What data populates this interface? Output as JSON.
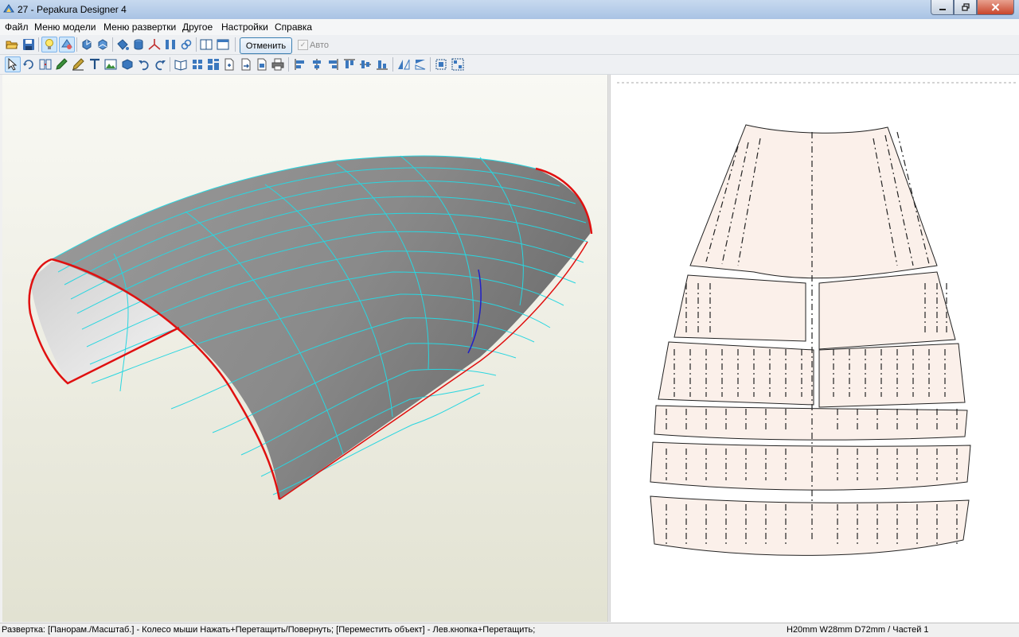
{
  "window": {
    "title": "27 - Pepakura Designer 4"
  },
  "menu": [
    "Файл",
    "Меню модели",
    "Меню развертки",
    "Другое",
    "Настройки",
    "Справка"
  ],
  "toolbar": {
    "undo_label": "Отменить",
    "auto_label": "Авто",
    "auto_checked": true
  },
  "toolbar1_icons": [
    "open-icon",
    "save-icon",
    "lightbulb-icon",
    "texture-icon",
    "rotate-model-icon",
    "flip-model-icon",
    "paint-bucket-icon",
    "cylinder-icon",
    "axes-icon",
    "split-view-icon",
    "link-icon",
    "dual-pane-icon",
    "single-pane-icon"
  ],
  "toolbar2_icons": [
    "select-arrow-icon",
    "rotate-part-icon",
    "join-parts-icon",
    "pen-edit-icon",
    "flap-edit-icon",
    "text-icon",
    "image-icon",
    "cube-icon",
    "undo-arrow-icon",
    "redo-arrow-icon",
    "unfold-book-icon",
    "pattern-grid-icon",
    "parts-layout-icon",
    "page-add-icon",
    "page-export-icon",
    "page-move-icon",
    "printer-icon",
    "align-left-icon",
    "align-center-icon",
    "align-right-icon",
    "align-top-icon",
    "align-middle-icon",
    "align-bottom-icon",
    "mirror-h-icon",
    "mirror-v-icon",
    "fit-page-icon",
    "multi-select-icon"
  ],
  "status": {
    "text": "Развертка: [Панорам./Масштаб.] - Колесо мыши Нажать+Перетащить/Повернуть; [Переместить объект] - Лев.кнопка+Перетащить;",
    "dims": "H20mm W28mm D72mm / Частей 1"
  },
  "colors": {
    "edge_cut": "#e01010",
    "edge_fold": "#29d6e0",
    "edge_valley": "#2020c8",
    "part_fill": "#fbf0ea",
    "model_shade": "#8c8c8c"
  }
}
